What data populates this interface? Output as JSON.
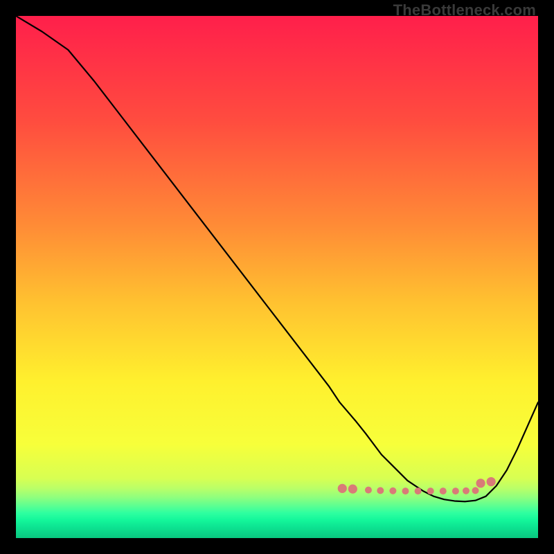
{
  "watermark": "TheBottleneck.com",
  "chart_data": {
    "type": "line",
    "title": "",
    "xlabel": "",
    "ylabel": "",
    "xlim": [
      0,
      100
    ],
    "ylim": [
      0,
      100
    ],
    "grid": false,
    "legend": false,
    "series": [
      {
        "name": "curve",
        "x": [
          0,
          5,
          10,
          15,
          20,
          25,
          30,
          35,
          40,
          45,
          50,
          55,
          60,
          62,
          65,
          67,
          70,
          72,
          75,
          78,
          80,
          82,
          84,
          86,
          88,
          90,
          92,
          94,
          96,
          98,
          100
        ],
        "y": [
          100,
          97,
          93.5,
          87.5,
          81,
          74.5,
          68,
          61.5,
          55,
          48.5,
          42,
          35.5,
          29,
          26,
          22.5,
          20,
          16,
          14,
          11,
          9,
          8,
          7.4,
          7.1,
          7,
          7.2,
          8,
          10,
          13,
          17,
          21.5,
          26
        ]
      }
    ],
    "markers": {
      "name": "dots",
      "x": [
        62.5,
        64.5,
        67.5,
        69.8,
        72.2,
        74.6,
        77.0,
        79.4,
        81.8,
        84.2,
        86.2,
        88.0,
        89.0,
        91.0
      ],
      "y": [
        9.5,
        9.4,
        9.2,
        9.1,
        9.05,
        9.0,
        9.0,
        9.0,
        9.0,
        9.0,
        9.05,
        9.1,
        10.5,
        10.8
      ]
    },
    "background_gradient": {
      "stops": [
        {
          "offset": 0.0,
          "color": "#ff1f4b"
        },
        {
          "offset": 0.2,
          "color": "#ff4c3f"
        },
        {
          "offset": 0.4,
          "color": "#ff8b36"
        },
        {
          "offset": 0.55,
          "color": "#ffc230"
        },
        {
          "offset": 0.7,
          "color": "#fff02e"
        },
        {
          "offset": 0.82,
          "color": "#f7ff3a"
        },
        {
          "offset": 0.885,
          "color": "#d8ff52"
        },
        {
          "offset": 0.905,
          "color": "#b9ff68"
        },
        {
          "offset": 0.922,
          "color": "#8fff7e"
        },
        {
          "offset": 0.938,
          "color": "#5dff91"
        },
        {
          "offset": 0.952,
          "color": "#2effa0"
        },
        {
          "offset": 0.965,
          "color": "#14f79b"
        },
        {
          "offset": 0.978,
          "color": "#0de592"
        },
        {
          "offset": 1.0,
          "color": "#09c780"
        }
      ]
    },
    "line_color": "#000000",
    "line_width": 2.2,
    "marker_color": "#d97a78",
    "marker_radius_small": 5.0,
    "marker_radius_large": 6.6
  }
}
